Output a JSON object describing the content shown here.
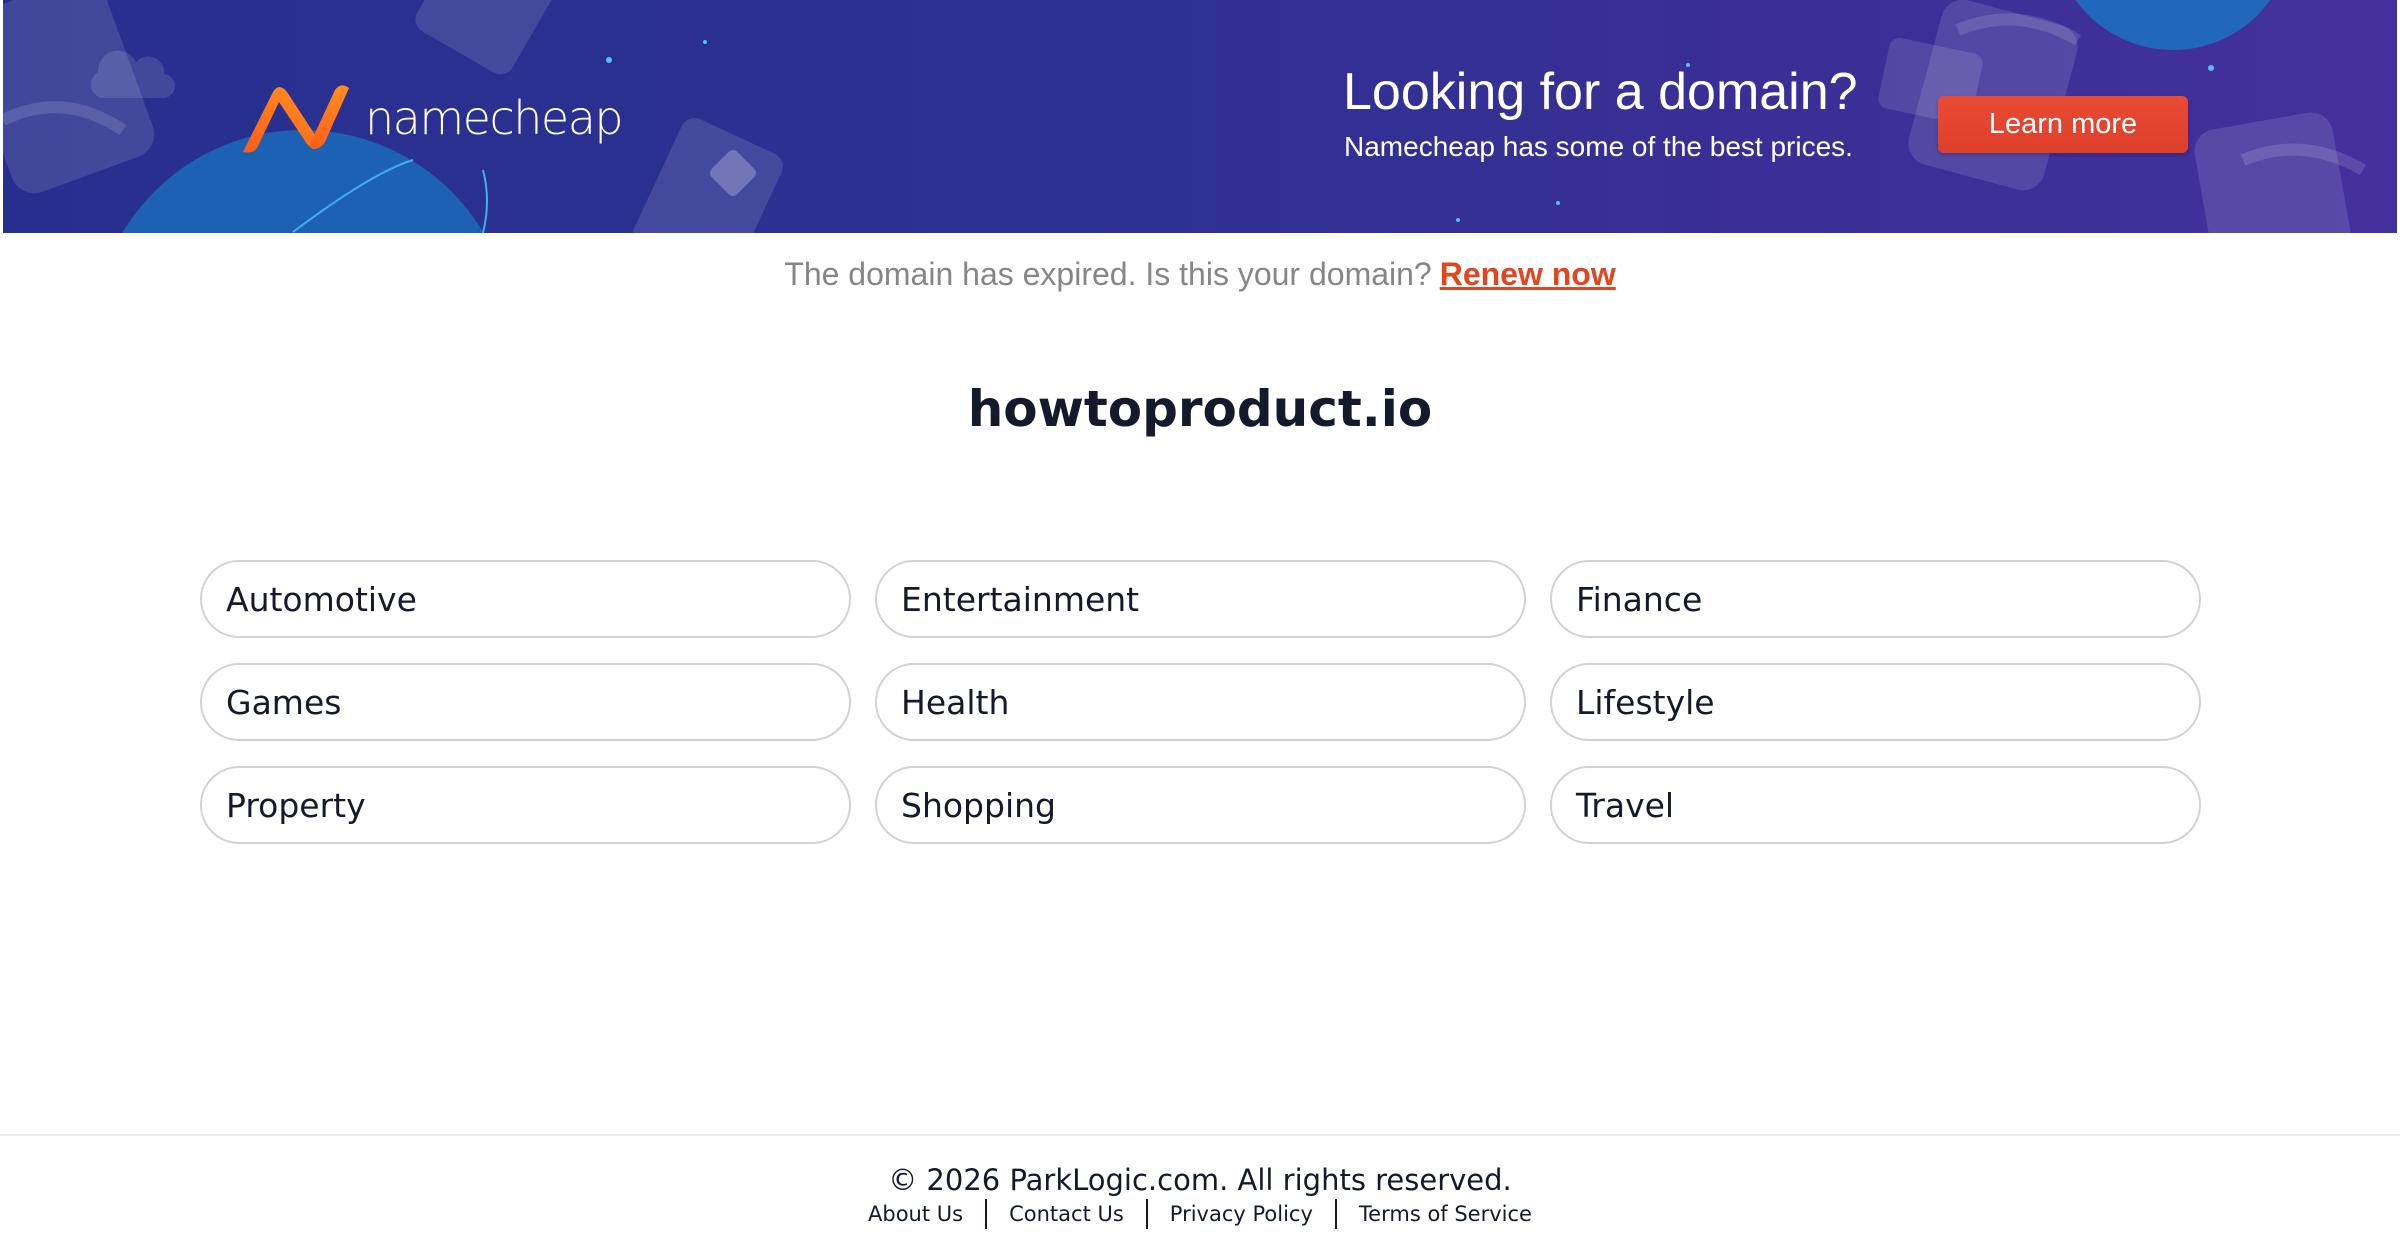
{
  "banner": {
    "brand": "namecheap",
    "title": "Looking for a domain?",
    "subtitle": "Namecheap has some of the best prices.",
    "cta_label": "Learn more",
    "colors": {
      "background": "#2d3192",
      "cta": "#e2452f",
      "logo_orange": "#ff6a1a"
    }
  },
  "notice": {
    "text": "The domain has expired. Is this your domain?",
    "link_label": "Renew now",
    "link_color": "#e0461f"
  },
  "domain": "howtoproduct.io",
  "categories": [
    "Automotive",
    "Entertainment",
    "Finance",
    "Games",
    "Health",
    "Lifestyle",
    "Property",
    "Shopping",
    "Travel"
  ],
  "footer": {
    "copyright": "© 2026 ParkLogic.com. All rights reserved.",
    "links": [
      "About Us",
      "Contact Us",
      "Privacy Policy",
      "Terms of Service"
    ]
  }
}
